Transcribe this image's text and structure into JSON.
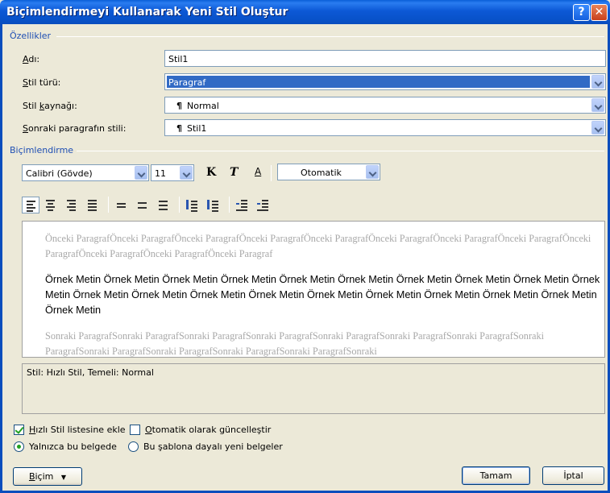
{
  "window": {
    "title": "Biçimlendirmeyi Kullanarak Yeni Stil Oluştur",
    "help_icon": "question-icon",
    "close_icon": "close-icon"
  },
  "properties": {
    "section_label": "Özellikler",
    "name_label_u": "A",
    "name_label_rest": "dı:",
    "name_value": "Stil1",
    "type_label_u": "S",
    "type_label_rest": "til türü:",
    "type_value": "Paragraf",
    "based_label_pre": "Stil ",
    "based_label_u": "k",
    "based_label_rest": "aynağı:",
    "based_value": "Normal",
    "next_label_u": "S",
    "next_label_rest": "onraki paragrafın stili:",
    "next_value": "Stil1",
    "pilcrow": "¶"
  },
  "formatting": {
    "section_label": "Biçimlendirme",
    "font_name": "Calibri (Gövde)",
    "font_size": "11",
    "bold": "K",
    "italic": "T",
    "underline": "A",
    "color": "Otomatik"
  },
  "preview": {
    "prev_text": "Önceki ParagrafÖnceki ParagrafÖnceki ParagrafÖnceki ParagrafÖnceki ParagrafÖnceki ParagrafÖnceki ParagrafÖnceki ParagrafÖnceki ParagrafÖnceki ParagrafÖnceki ParagrafÖnceki Paragraf",
    "sample_text": "Örnek Metin Örnek Metin Örnek Metin Örnek Metin Örnek Metin Örnek Metin Örnek Metin Örnek Metin Örnek Metin Örnek Metin Örnek Metin Örnek Metin Örnek Metin Örnek Metin Örnek Metin Örnek Metin Örnek Metin Örnek Metin Örnek Metin Örnek Metin",
    "next_text": "Sonraki ParagrafSonraki ParagrafSonraki ParagrafSonraki ParagrafSonraki ParagrafSonraki ParagrafSonraki ParagrafSonraki ParagrafSonraki ParagrafSonraki ParagrafSonraki ParagrafSonraki ParagrafSonraki"
  },
  "description": "Stil: Hızlı Stil, Temeli: Normal",
  "options": {
    "quick_style_u": "H",
    "quick_style_rest": "ızlı Stil listesine ekle",
    "quick_style_checked": true,
    "auto_update_u": "O",
    "auto_update_rest": "tomatik olarak güncelleştir",
    "auto_update_checked": false,
    "only_doc": "Yalnızca bu belgede",
    "only_doc_selected": true,
    "template_docs": "Bu şablona dayalı yeni belgeler",
    "template_docs_selected": false
  },
  "buttons": {
    "format_u": "B",
    "format_rest": "içim",
    "ok": "Tamam",
    "cancel": "İptal"
  }
}
